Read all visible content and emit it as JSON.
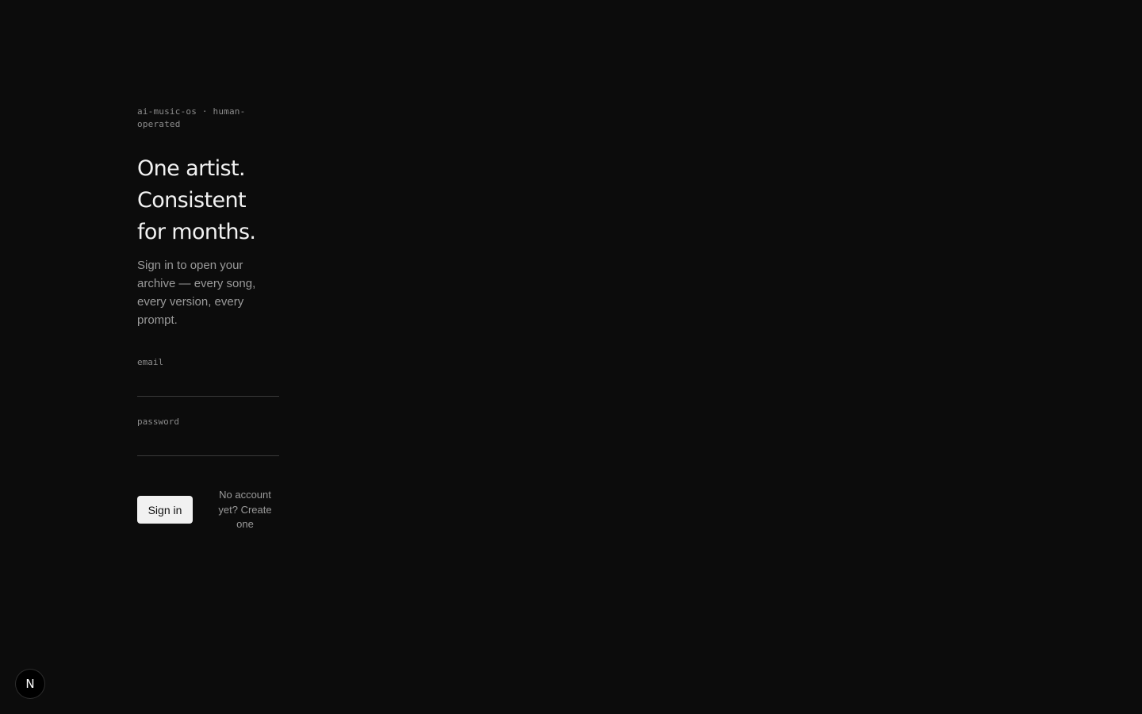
{
  "brand": {
    "eyebrow": "ai-music-os · human-operated"
  },
  "hero": {
    "headline_lines": [
      "One artist.",
      "Consistent",
      "for months."
    ],
    "subtitle": "Sign in to open your archive — every song, every version, every prompt."
  },
  "form": {
    "email_label": "email",
    "email_value": "",
    "password_label": "password",
    "password_value": "",
    "submit_label": "Sign in",
    "create_account_link": "No account yet? Create one"
  },
  "dev_badge": {
    "letter": "N",
    "icon": "nextjs-logo-icon"
  }
}
